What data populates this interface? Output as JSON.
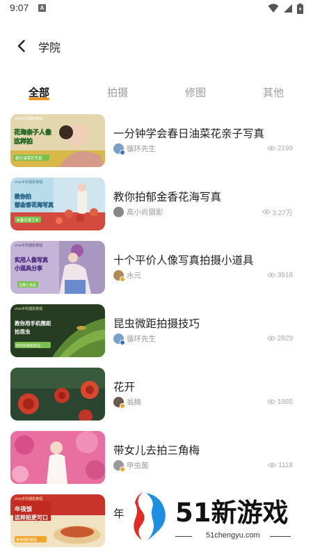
{
  "status_bar": {
    "time": "9:07",
    "notification_letter": "A"
  },
  "header": {
    "title": "学院"
  },
  "tabs": [
    {
      "label": "全部",
      "active": true
    },
    {
      "label": "拍摄",
      "active": false
    },
    {
      "label": "修图",
      "active": false
    },
    {
      "label": "其他",
      "active": false
    }
  ],
  "items": [
    {
      "title": "一分钟学会春日油菜花亲子写真",
      "author": "循环先生",
      "views": "2199",
      "thumb_text": [
        "vivo手机摄影教程",
        "花海亲子人像",
        "这样拍",
        "春日油菜花写真"
      ],
      "colors": {
        "bg1": "#d9c79a",
        "bg2": "#e8e0c0",
        "avatar": "#7aa0c8",
        "badge": "#3a6fd8"
      }
    },
    {
      "title": "教你拍郁金香花海写真",
      "author": "高小尚摄影",
      "views": "3.27万",
      "thumb_text": [
        "vivo手机摄影教程",
        "教你拍",
        "郁金香花海写真",
        "#春天来了#"
      ],
      "colors": {
        "bg1": "#a9cfe0",
        "bg2": "#d4524a",
        "avatar": "#888888",
        "badge": "#ffffff"
      }
    },
    {
      "title": "十个平价人像写真拍摄小道具",
      "author": "水元",
      "views": "3918",
      "thumb_text": [
        "vivo手机摄影教程",
        "实用人像写真",
        "小道具分享",
        "宝藏小道具"
      ],
      "colors": {
        "bg1": "#b7a6c8",
        "bg2": "#8a79a8",
        "avatar": "#b08a5a",
        "badge": "#f1a52a"
      }
    },
    {
      "title": "昆虫微距拍摄技巧",
      "author": "循环先生",
      "views": "2829",
      "thumb_text": [
        "vivo手机摄影教程",
        "教你用手机微距",
        "拍昆虫",
        "如何快速拍昆虫"
      ],
      "colors": {
        "bg1": "#2f4a2a",
        "bg2": "#6a8f3a",
        "avatar": "#7aa0c8",
        "badge": "#3a6fd8"
      }
    },
    {
      "title": "花开",
      "author": "翁楠",
      "views": "1985",
      "thumb_text": [],
      "colors": {
        "bg1": "#2c4a30",
        "bg2": "#c73b2a",
        "avatar": "#6b5a4a",
        "badge": "#f1a52a"
      }
    },
    {
      "title": "带女儿去拍三角梅",
      "author": "甲虫菌",
      "views": "1118",
      "thumb_text": [],
      "colors": {
        "bg1": "#d8508a",
        "bg2": "#f4c6d8",
        "avatar": "#999999",
        "badge": "#f1a52a"
      }
    },
    {
      "title": "年",
      "author": "",
      "views": "",
      "thumb_text": [
        "vivo手机摄影教程",
        "年夜饭",
        "这样拍更可口",
        "美食摄影教程"
      ],
      "colors": {
        "bg1": "#c02a20",
        "bg2": "#f0d7b0",
        "avatar": "#999999",
        "badge": "#f1a52a"
      }
    }
  ],
  "watermark": {
    "text": "51新游戏",
    "url": "51chengyu.com"
  }
}
